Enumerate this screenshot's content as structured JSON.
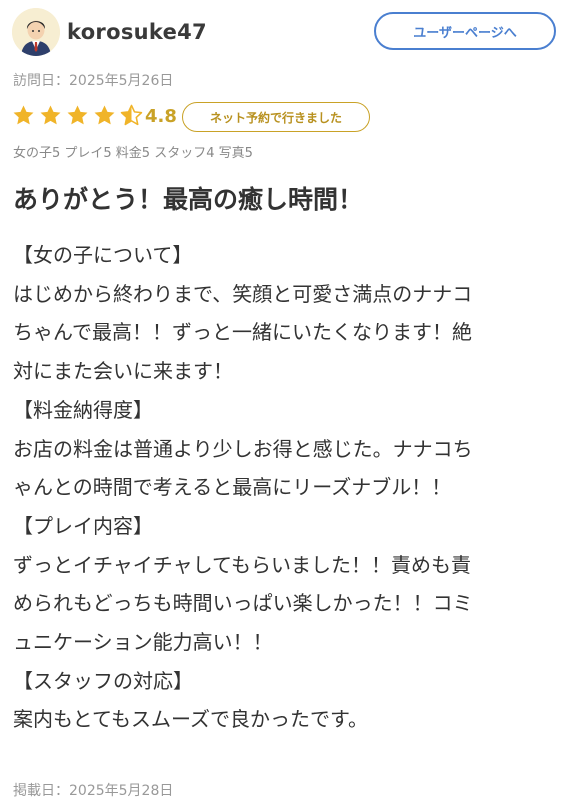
{
  "user": {
    "name": "korosuke47",
    "avatar_icon": "user-avatar-icon",
    "user_page_button": "ユーザーページへ"
  },
  "visit_date": "訪問日：2025年5月26日",
  "rating": {
    "stars": 4.5,
    "value": "4.8",
    "star_color": "#f0b429",
    "booking_badge": "ネット予約で行きました"
  },
  "sub_ratings": "女の子5 プレイ5 料金5 スタッフ4 写真5",
  "review": {
    "title": "ありがとう！最高の癒し時間！",
    "lines": [
      "【女の子について】",
      "はじめから終わりまで、笑顔と可愛さ満点のナナコ",
      "ちゃんで最高！！ずっと一緒にいたくなります！絶",
      "対にまた会いに来ます！",
      "【料金納得度】",
      "お店の料金は普通より少しお得と感じた。ナナコち",
      "ゃんとの時間で考えると最高にリーズナブル！！",
      "【プレイ内容】",
      "ずっとイチャイチャしてもらいました！！責めも責",
      "められもどっちも時間いっぱい楽しかった！！コミ",
      "ュニケーション能力高い！！",
      "【スタッフの対応】",
      "案内もとてもスムーズで良かったです。"
    ]
  },
  "posted_date": "掲載日：2025年5月28日"
}
